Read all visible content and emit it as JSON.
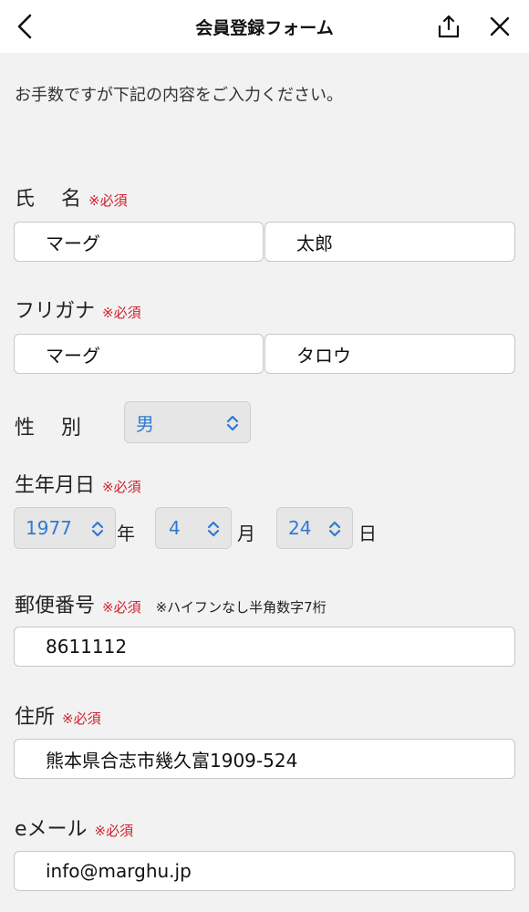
{
  "header": {
    "title": "会員登録フォーム",
    "back_icon": "chevron-left-icon",
    "share_icon": "share-icon",
    "close_icon": "close-icon"
  },
  "intro": "お手数ですが下記の内容をご入力ください。",
  "required_mark": "※必須",
  "fields": {
    "name": {
      "label": "氏　 名",
      "last": "マーグ",
      "first": "太郎"
    },
    "furigana": {
      "label": "フリガナ",
      "last": "マーグ",
      "first": "タロウ"
    },
    "gender": {
      "label": "性　 別",
      "value": "男"
    },
    "birthdate": {
      "label": "生年月日",
      "year": "1977",
      "year_unit": "年",
      "month": "4",
      "month_unit": "月",
      "day": "24",
      "day_unit": "日"
    },
    "postal": {
      "label": "郵便番号",
      "note": "※ハイフンなし半角数字7桁",
      "value": "8611112"
    },
    "address": {
      "label": "住所",
      "value": "熊本県合志市幾久富1909-524"
    },
    "email": {
      "label": "eメール",
      "value": "info@marghu.jp"
    }
  },
  "colors": {
    "required": "#d0202f",
    "select_text": "#2f7ad1",
    "background": "#f2f2f2"
  }
}
